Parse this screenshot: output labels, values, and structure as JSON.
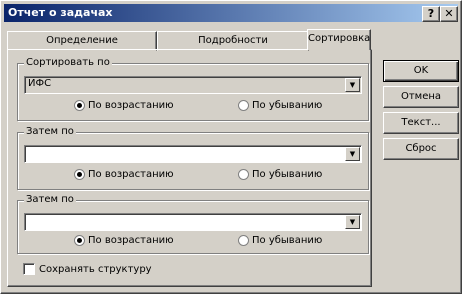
{
  "window": {
    "title": "Отчет о задачах",
    "help_glyph": "?",
    "close_glyph": "✕"
  },
  "tabs": [
    {
      "label": "Определение"
    },
    {
      "label": "Подробности"
    },
    {
      "label": "Сортировка",
      "active": true
    }
  ],
  "sort_by": {
    "label": "Сортировать по",
    "value": "ИФС",
    "asc_label": "По возрастанию",
    "desc_label": "По убыванию",
    "selected": "asc"
  },
  "then_by_1": {
    "label": "Затем по",
    "value": "",
    "asc_label": "По возрастанию",
    "desc_label": "По убыванию",
    "selected": "asc"
  },
  "then_by_2": {
    "label": "Затем по",
    "value": "",
    "asc_label": "По возрастанию",
    "desc_label": "По убыванию",
    "selected": "asc"
  },
  "buttons": {
    "ok": "OK",
    "cancel": "Отмена",
    "text": "Текст...",
    "reset": "Сброс"
  },
  "keep_structure": {
    "label": "Сохранять структуру",
    "checked": false
  }
}
